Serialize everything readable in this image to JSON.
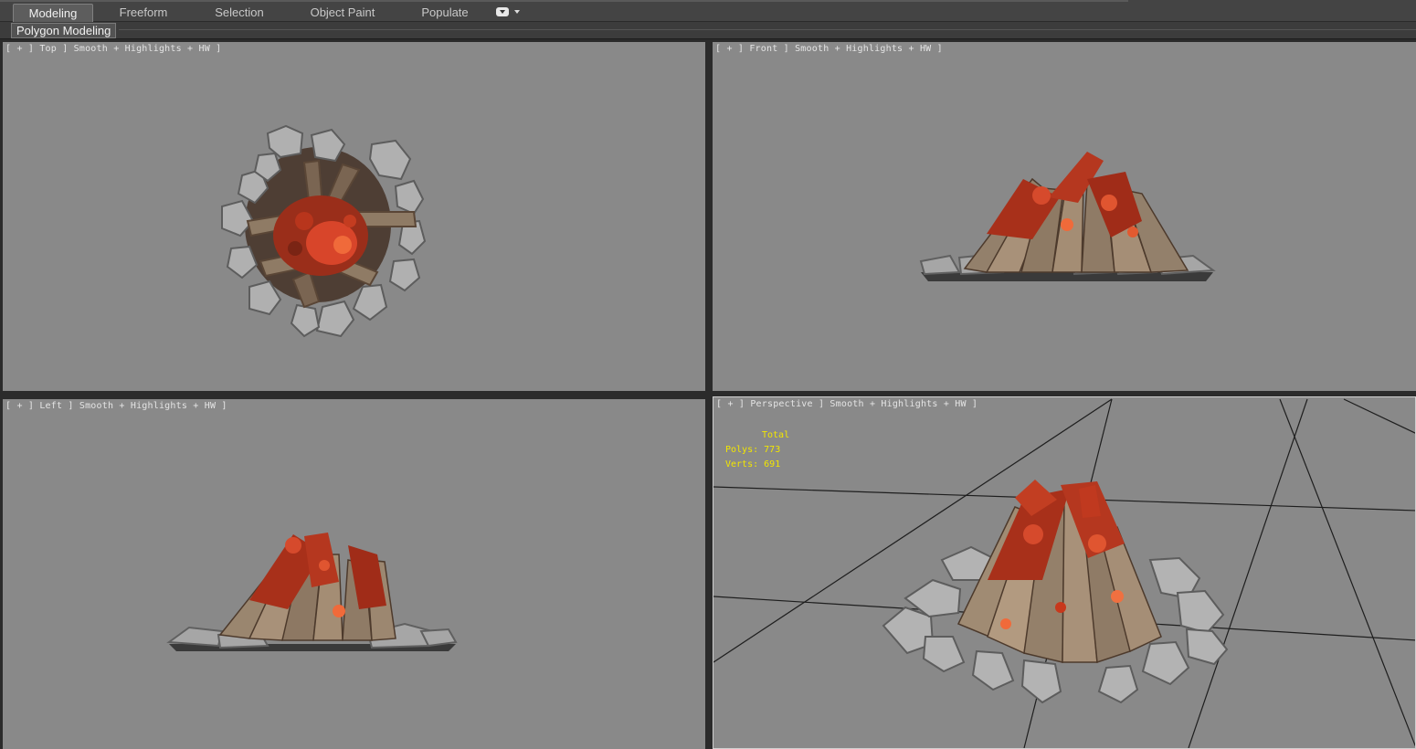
{
  "ribbon": {
    "tabs": [
      {
        "label": "Modeling",
        "active": true
      },
      {
        "label": "Freeform"
      },
      {
        "label": "Selection"
      },
      {
        "label": "Object Paint"
      },
      {
        "label": "Populate"
      }
    ],
    "dropdown_icon": "chevron-down-icon"
  },
  "panel": {
    "title": "Polygon Modeling"
  },
  "viewports": {
    "top": {
      "label": "[ + ] Top ] Smooth + Highlights + HW ]"
    },
    "front": {
      "label": "[ + ] Front ] Smooth + Highlights + HW ]"
    },
    "left": {
      "label": "[ + ] Left ] Smooth + Highlights + HW ]"
    },
    "perspective": {
      "label": "[ + ] Perspective ] Smooth + Highlights + HW ]"
    }
  },
  "stats": {
    "title": "Total",
    "polys_label": "Polys:",
    "polys": "773",
    "verts_label": "Verts:",
    "verts": "691"
  },
  "colors": {
    "viewport_bg": "#898989",
    "stats_text": "#f2e600",
    "ember": "#c8381c",
    "stone": "#a9a9a9",
    "wood": "#9c8770"
  }
}
